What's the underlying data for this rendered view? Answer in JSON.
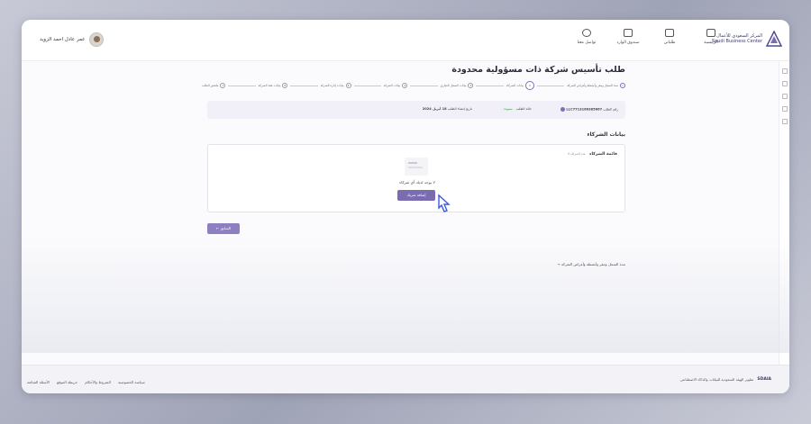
{
  "header": {
    "logo_ar": "المركز السعودي للأعمال",
    "logo_en": "Saudi Business Center",
    "nav": [
      {
        "label": "الرئيسية",
        "icon": "home-icon"
      },
      {
        "label": "طلباتي",
        "icon": "document-icon"
      },
      {
        "label": "صندوق الوارد",
        "icon": "inbox-icon"
      },
      {
        "label": "تواصل معنا",
        "icon": "contact-icon"
      }
    ],
    "user_name": "عمر عادل احمد الزويد"
  },
  "page": {
    "title": "طلب تأسيس شركة ذات مسؤولية محدودة",
    "steps": [
      {
        "num": "1",
        "label": "مدة السجل ومقر وأنشطة وأغراض الشركة",
        "state": "done"
      },
      {
        "num": "2",
        "label": "بيانات الشركاء",
        "state": "active"
      },
      {
        "num": "3",
        "label": "بيانات السجل التجاري",
        "state": "pending"
      },
      {
        "num": "4",
        "label": "بيانات الشركة",
        "state": "pending"
      },
      {
        "num": "5",
        "label": "بيانات إدارة الشركة",
        "state": "pending"
      },
      {
        "num": "6",
        "label": "بيانات عقد الشركة",
        "state": "pending"
      },
      {
        "num": "7",
        "label": "ملخص الطلب",
        "state": "pending"
      }
    ],
    "info": {
      "request_no_label": "رقم الطلب",
      "request_no": "LLC7713166385667",
      "status_label": "حالة الطلب",
      "status": "مسودة",
      "date_label": "تاريخ إنشاء الطلب",
      "date": "18 أبريل 2024"
    },
    "section_title": "بيانات الشركاء",
    "card": {
      "title": "قائمة الشركاء",
      "subtitle": "عدد الشركاء 0",
      "empty_text": "لا يوجد لديك أي شركاء",
      "add_button": "إضافة شريك"
    },
    "back_button": "السابق",
    "prev_link": "مدة السجل ومقر وأنشطة وأغراض الشركة"
  },
  "footer": {
    "right_text": "تطوير الهيئة السعودية للبيانات والذكاء الاصطناعي",
    "sdaia": "SDAIA",
    "links": [
      "سياسة الخصوصية",
      "الشروط والأحكام",
      "خريطة الموقع",
      "الأسئلة الشائعة"
    ]
  },
  "colors": {
    "accent": "#7b6bb0",
    "status_green": "#2e8b57"
  }
}
